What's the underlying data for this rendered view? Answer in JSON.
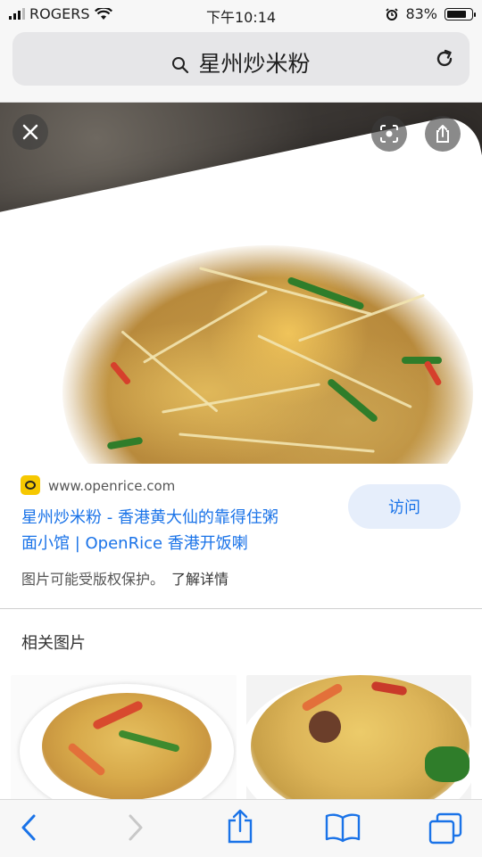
{
  "status": {
    "carrier": "ROGERS",
    "time": "下午10:14",
    "battery": "83%",
    "battery_level": 0.83
  },
  "search": {
    "query": "星州炒米粉"
  },
  "result": {
    "domain": "www.openrice.com",
    "title_line1": "星州炒米粉 - 香港黄大仙的靠得住粥",
    "title_line2": "面小馆 | OpenRice 香港开饭喇",
    "visit_label": "访问",
    "copyright_note": "图片可能受版权保护。",
    "learn_more": "了解详情"
  },
  "related": {
    "heading": "相关图片"
  },
  "icons": {
    "close": "close-icon",
    "lens": "lens-icon",
    "share": "share-icon",
    "reload": "reload-icon",
    "search": "search-icon"
  },
  "colors": {
    "link": "#1a73e8",
    "visit_bg": "#e6eefb",
    "favicon": "#f6c800"
  }
}
